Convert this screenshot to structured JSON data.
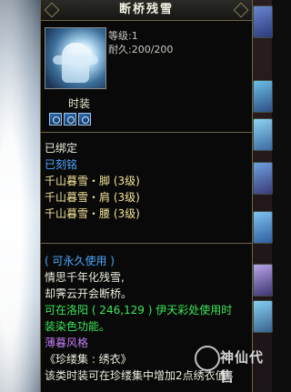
{
  "tooltip": {
    "title": "断桥残雪",
    "level": "等级:1",
    "durability": "耐久:200/200",
    "type_label": "时装",
    "status_bound": "已绑定",
    "status_engraved": "已刻铭",
    "set_pieces": [
      "千山暮雪・脚 (3级)",
      "千山暮雪・肩 (3级)",
      "千山暮雪・腰 (3级)"
    ],
    "usage": "( 可永久使用 )",
    "description": [
      "情思千年化残雪,",
      "却霁云开会断桥。"
    ],
    "dye_info": [
      "可在洛阳 ( 246,129 ) 伊天彩处使用时",
      "装染色功能。"
    ],
    "style_label": "薄暮风格",
    "collection_name": "《珍缕集 : 绣衣》",
    "collection_effect": "该类时装可在珍缕集中增加2点绣衣值"
  },
  "watermark": {
    "text": "神仙代售",
    "sub": ""
  },
  "colors": {
    "panel_border": "#6d6448",
    "label_blue": "#4fa8ff",
    "set_gold": "#f4e19a",
    "dye_green": "#3ee85b",
    "style_purple": "#c07bf2"
  },
  "icons": {
    "gem_slots": [
      "gem-slot-icon",
      "gem-slot-icon",
      "gem-slot-icon"
    ],
    "skill_bar": [
      "skill-icon",
      "skill-icon",
      "skill-icon",
      "skill-icon",
      "skill-icon",
      "skill-icon",
      "skill-icon"
    ]
  }
}
